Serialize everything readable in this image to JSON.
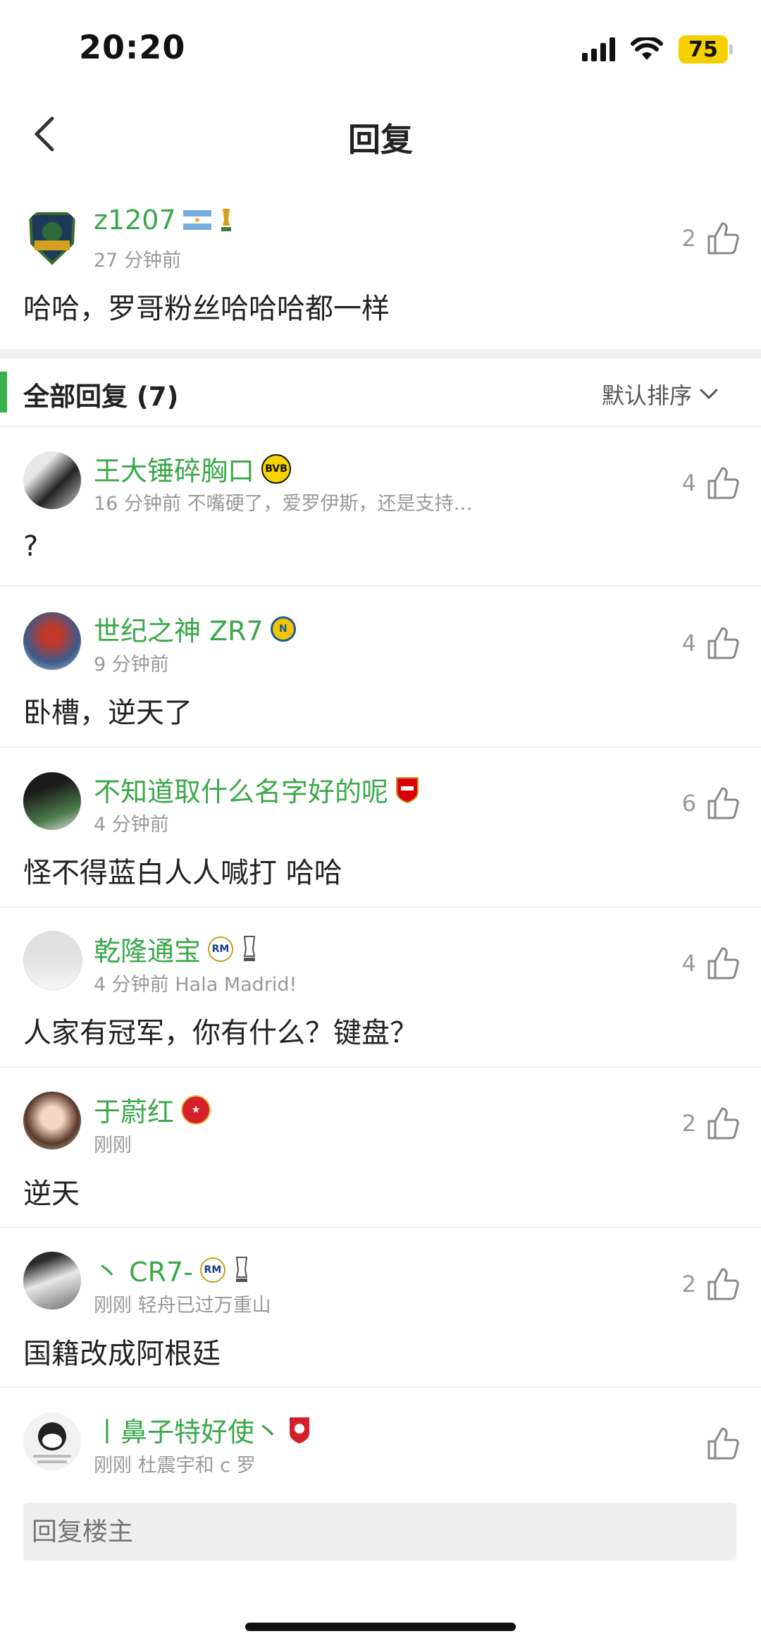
{
  "status_bar": {
    "time": "20:20",
    "battery": "75"
  },
  "nav": {
    "title": "回复"
  },
  "op": {
    "username": "z1207",
    "time": "27 分钟前",
    "likes": "2",
    "text": "哈哈，罗哥粉丝哈哈哈都一样"
  },
  "section": {
    "title": "全部回复 (7)",
    "sort_label": "默认排序"
  },
  "replies": [
    {
      "username": "王大锤碎胸口",
      "time": "16 分钟前",
      "extra": "不嘴硬了，爱罗伊斯，还是支持…",
      "likes": "4",
      "text": "?"
    },
    {
      "username": "世纪之神 ZR7",
      "time": "9 分钟前",
      "extra": "",
      "likes": "4",
      "text": "卧槽，逆天了"
    },
    {
      "username": "不知道取什么名字好的呢",
      "time": "4 分钟前",
      "extra": "",
      "likes": "6",
      "text": "怪不得蓝白人人喊打 哈哈"
    },
    {
      "username": "乾隆通宝",
      "time": "4 分钟前",
      "extra": "Hala Madrid!",
      "likes": "4",
      "text": "人家有冠军，你有什么？键盘？"
    },
    {
      "username": "于蔚红",
      "time": "刚刚",
      "extra": "",
      "likes": "2",
      "text": "逆天"
    },
    {
      "username": "丶 CR7-",
      "time": "刚刚",
      "extra": "轻舟已过万重山",
      "likes": "2",
      "text": "国籍改成阿根廷"
    },
    {
      "username": "丨鼻子特好使丶",
      "time": "刚刚",
      "extra": "杜震宇和 c 罗",
      "likes": "",
      "text": ""
    }
  ],
  "input": {
    "placeholder": "回复楼主"
  },
  "colors": {
    "accent": "#3aa84a",
    "battery": "#f5d000"
  }
}
